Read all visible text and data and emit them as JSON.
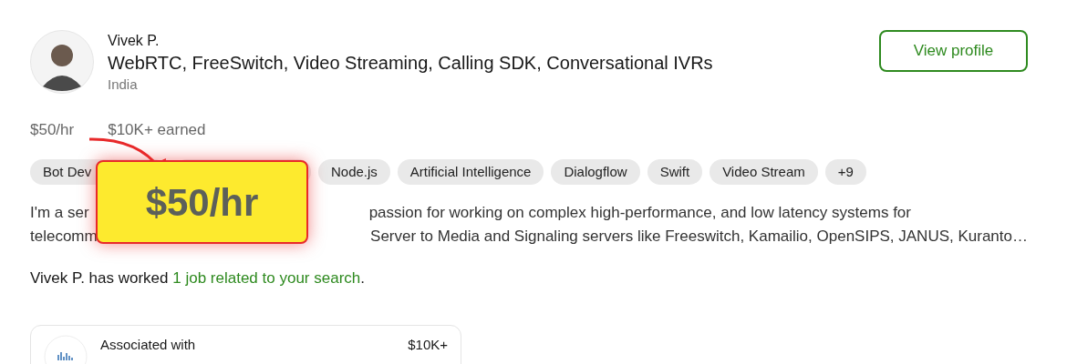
{
  "profile": {
    "name": "Vivek P.",
    "title": "WebRTC, FreeSwitch, Video Streaming, Calling SDK, Conversational IVRs",
    "location": "India",
    "view_button": "View profile"
  },
  "stats": [
    "$50/hr",
    "$10K+ earned"
  ],
  "skills": [
    {
      "kind": "tag",
      "label": "Bot Dev"
    },
    {
      "kind": "covered"
    },
    {
      "kind": "tag",
      "label": "Node.js"
    },
    {
      "kind": "tag",
      "label": "Artificial Intelligence"
    },
    {
      "kind": "tag",
      "label": "Dialogflow"
    },
    {
      "kind": "tag",
      "label": "Swift"
    },
    {
      "kind": "tag",
      "label": "Video Stream"
    },
    {
      "kind": "tag",
      "label": "+9"
    }
  ],
  "description": [
    {
      "start": "I'm a ser",
      "rest": "passion for working on complex high-performance, and low latency systems for"
    },
    {
      "start": "telecomm",
      "rest": "Server to Media and Signaling servers like Freeswitch, Kamailio, OpenSIPS, JANUS, Kuranto…"
    }
  ],
  "worked": {
    "prefix": "Vivek P. has worked",
    "link": "1 job related to your search",
    "suffix": "."
  },
  "callout": {
    "text": "$50/hr"
  },
  "job_card": {
    "label": "Associated with",
    "amount": "$10K+"
  }
}
